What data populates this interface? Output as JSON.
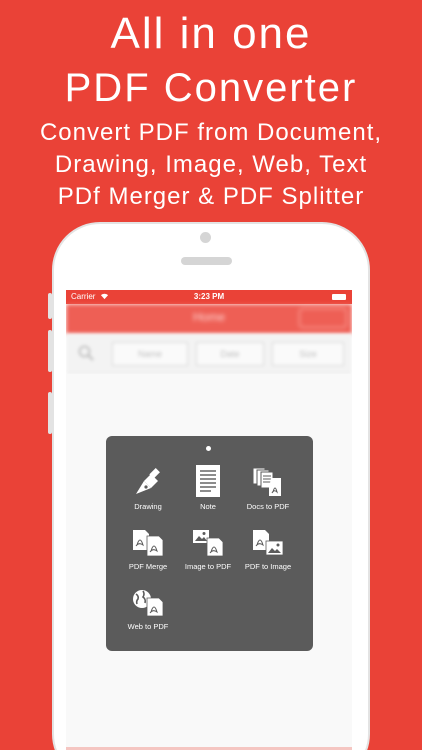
{
  "promo": {
    "headline_line1": "All in one",
    "headline_line2": "PDF Converter",
    "subline1": "Convert PDF from Document,",
    "subline2": "Drawing, Image, Web, Text",
    "subline3": "PDf Merger & PDF Splitter"
  },
  "status_bar": {
    "carrier": "Carrier",
    "time": "3:23 PM"
  },
  "nav": {
    "title": "Home"
  },
  "toolbar": {
    "buttons": [
      "Name",
      "Date",
      "Size"
    ]
  },
  "menu": {
    "items": [
      {
        "label": "Drawing",
        "icon": "pen-nib-icon"
      },
      {
        "label": "Note",
        "icon": "note-document-icon"
      },
      {
        "label": "Docs to PDF",
        "icon": "docs-to-pdf-icon"
      },
      {
        "label": "PDF Merge",
        "icon": "pdf-merge-icon"
      },
      {
        "label": "Image to PDF",
        "icon": "image-to-pdf-icon"
      },
      {
        "label": "PDF to Image",
        "icon": "pdf-to-image-icon"
      },
      {
        "label": "Web to PDF",
        "icon": "web-to-pdf-icon"
      }
    ]
  },
  "colors": {
    "brand_red": "#ea4237",
    "menu_gray": "#5b5b5b",
    "white": "#ffffff"
  }
}
